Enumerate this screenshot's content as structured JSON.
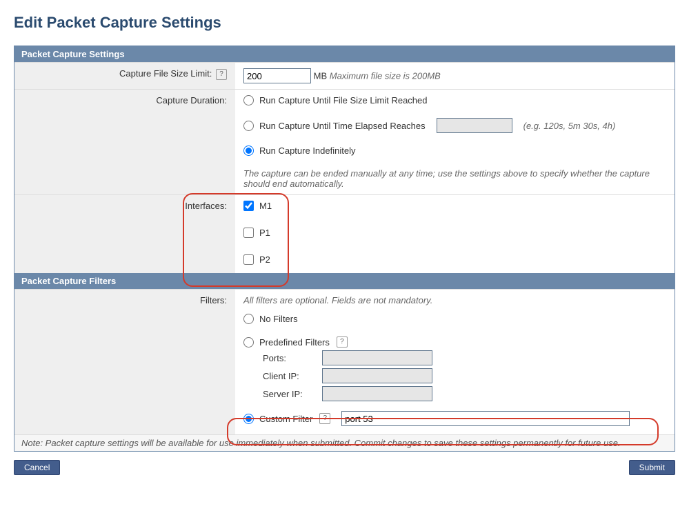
{
  "page": {
    "title": "Edit Packet Capture Settings"
  },
  "settings": {
    "header": "Packet Capture Settings",
    "fileSize": {
      "label": "Capture File Size Limit:",
      "value": "200",
      "unit": "MB",
      "hint": "Maximum file size is 200MB"
    },
    "duration": {
      "label": "Capture Duration:",
      "opt1": "Run Capture Until File Size Limit Reached",
      "opt2": "Run Capture Until Time Elapsed Reaches",
      "opt2hint": "(e.g. 120s, 5m 30s, 4h)",
      "opt3": "Run Capture Indefinitely",
      "note": "The capture can be ended manually at any time; use the settings above to specify whether the capture should end automatically."
    },
    "interfaces": {
      "label": "Interfaces:",
      "items": [
        "M1",
        "P1",
        "P2"
      ]
    }
  },
  "filters": {
    "header": "Packet Capture Filters",
    "label": "Filters:",
    "hint": "All filters are optional. Fields are not mandatory.",
    "opt1": "No Filters",
    "opt2": "Predefined Filters",
    "portsLabel": "Ports:",
    "clientLabel": "Client IP:",
    "serverLabel": "Server IP:",
    "opt3": "Custom Filter",
    "customValue": "port 53"
  },
  "footer": {
    "note": "Note: Packet capture settings will be available for use immediately when submitted. Commit changes to save these settings permanently for future use.",
    "cancel": "Cancel",
    "submit": "Submit"
  }
}
